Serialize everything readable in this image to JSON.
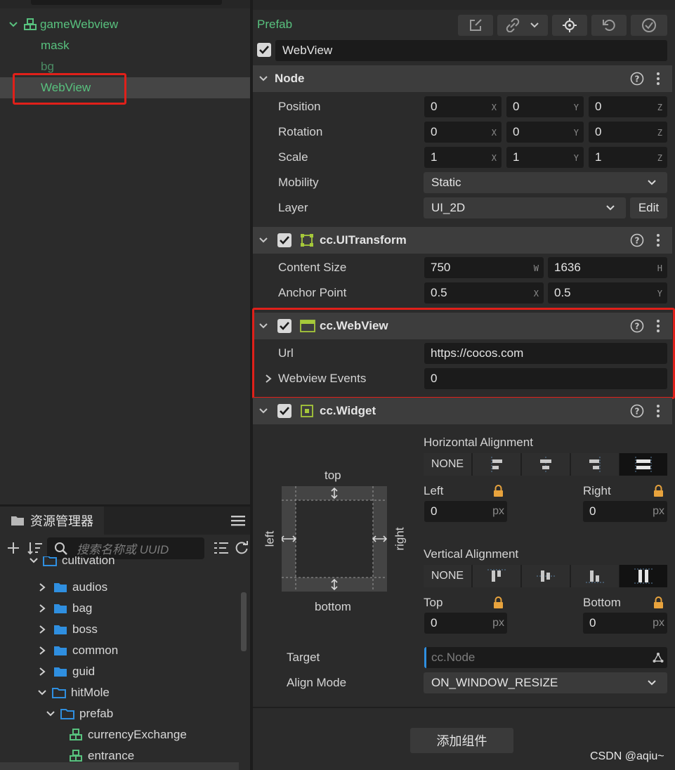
{
  "hierarchy": {
    "items": [
      {
        "label": "gameWebview"
      },
      {
        "label": "mask"
      },
      {
        "label": "bg"
      },
      {
        "label": "WebView"
      }
    ]
  },
  "assets": {
    "title": "资源管理器",
    "search_placeholder": "搜索名称或 UUID",
    "items": [
      {
        "label": "cultivation"
      },
      {
        "label": "audios"
      },
      {
        "label": "bag"
      },
      {
        "label": "boss"
      },
      {
        "label": "common"
      },
      {
        "label": "guid"
      },
      {
        "label": "hitMole"
      },
      {
        "label": "prefab"
      },
      {
        "label": "currencyExchange"
      },
      {
        "label": "entrance"
      }
    ]
  },
  "inspector": {
    "prefab_label": "Prefab",
    "node_name": "WebView",
    "node": {
      "title": "Node",
      "position_label": "Position",
      "rotation_label": "Rotation",
      "scale_label": "Scale",
      "mobility_label": "Mobility",
      "layer_label": "Layer",
      "position": [
        "0",
        "0",
        "0"
      ],
      "rotation": [
        "0",
        "0",
        "0"
      ],
      "scale": [
        "1",
        "1",
        "1"
      ],
      "axes": [
        "X",
        "Y",
        "Z"
      ],
      "mobility": "Static",
      "layer": "UI_2D",
      "edit_label": "Edit"
    },
    "uitransform": {
      "title": "cc.UITransform",
      "content_size_label": "Content Size",
      "anchor_point_label": "Anchor Point",
      "width": "750",
      "height": "1636",
      "w_axis": "W",
      "h_axis": "H",
      "anchor_x": "0.5",
      "anchor_y": "0.5",
      "x_axis": "X",
      "y_axis": "Y"
    },
    "webview": {
      "title": "cc.WebView",
      "url_label": "Url",
      "url": "https://cocos.com",
      "events_label": "Webview Events",
      "events": "0"
    },
    "widget": {
      "title": "cc.Widget",
      "h_align_label": "Horizontal Alignment",
      "v_align_label": "Vertical Alignment",
      "none_label": "NONE",
      "none_label_v": "NONE",
      "left_label": "Left",
      "right_label": "Right",
      "top_label": "Top",
      "bottom_label": "Bottom",
      "left": "0",
      "right": "0",
      "top": "0",
      "bottom": "0",
      "unit": "px",
      "diagram_top": "top",
      "diagram_bottom": "bottom",
      "diagram_left": "left",
      "diagram_right": "right",
      "target_label": "Target",
      "target_placeholder": "cc.Node",
      "align_mode_label": "Align Mode",
      "align_mode": "ON_WINDOW_RESIZE"
    },
    "add_component": "添加组件"
  },
  "watermark": "CSDN @aqiu~",
  "colors": {
    "accent_green": "#58c17e",
    "highlight_red": "#e0201a",
    "lock_orange": "#e8a33d",
    "folder_blue": "#2f8fe0"
  }
}
